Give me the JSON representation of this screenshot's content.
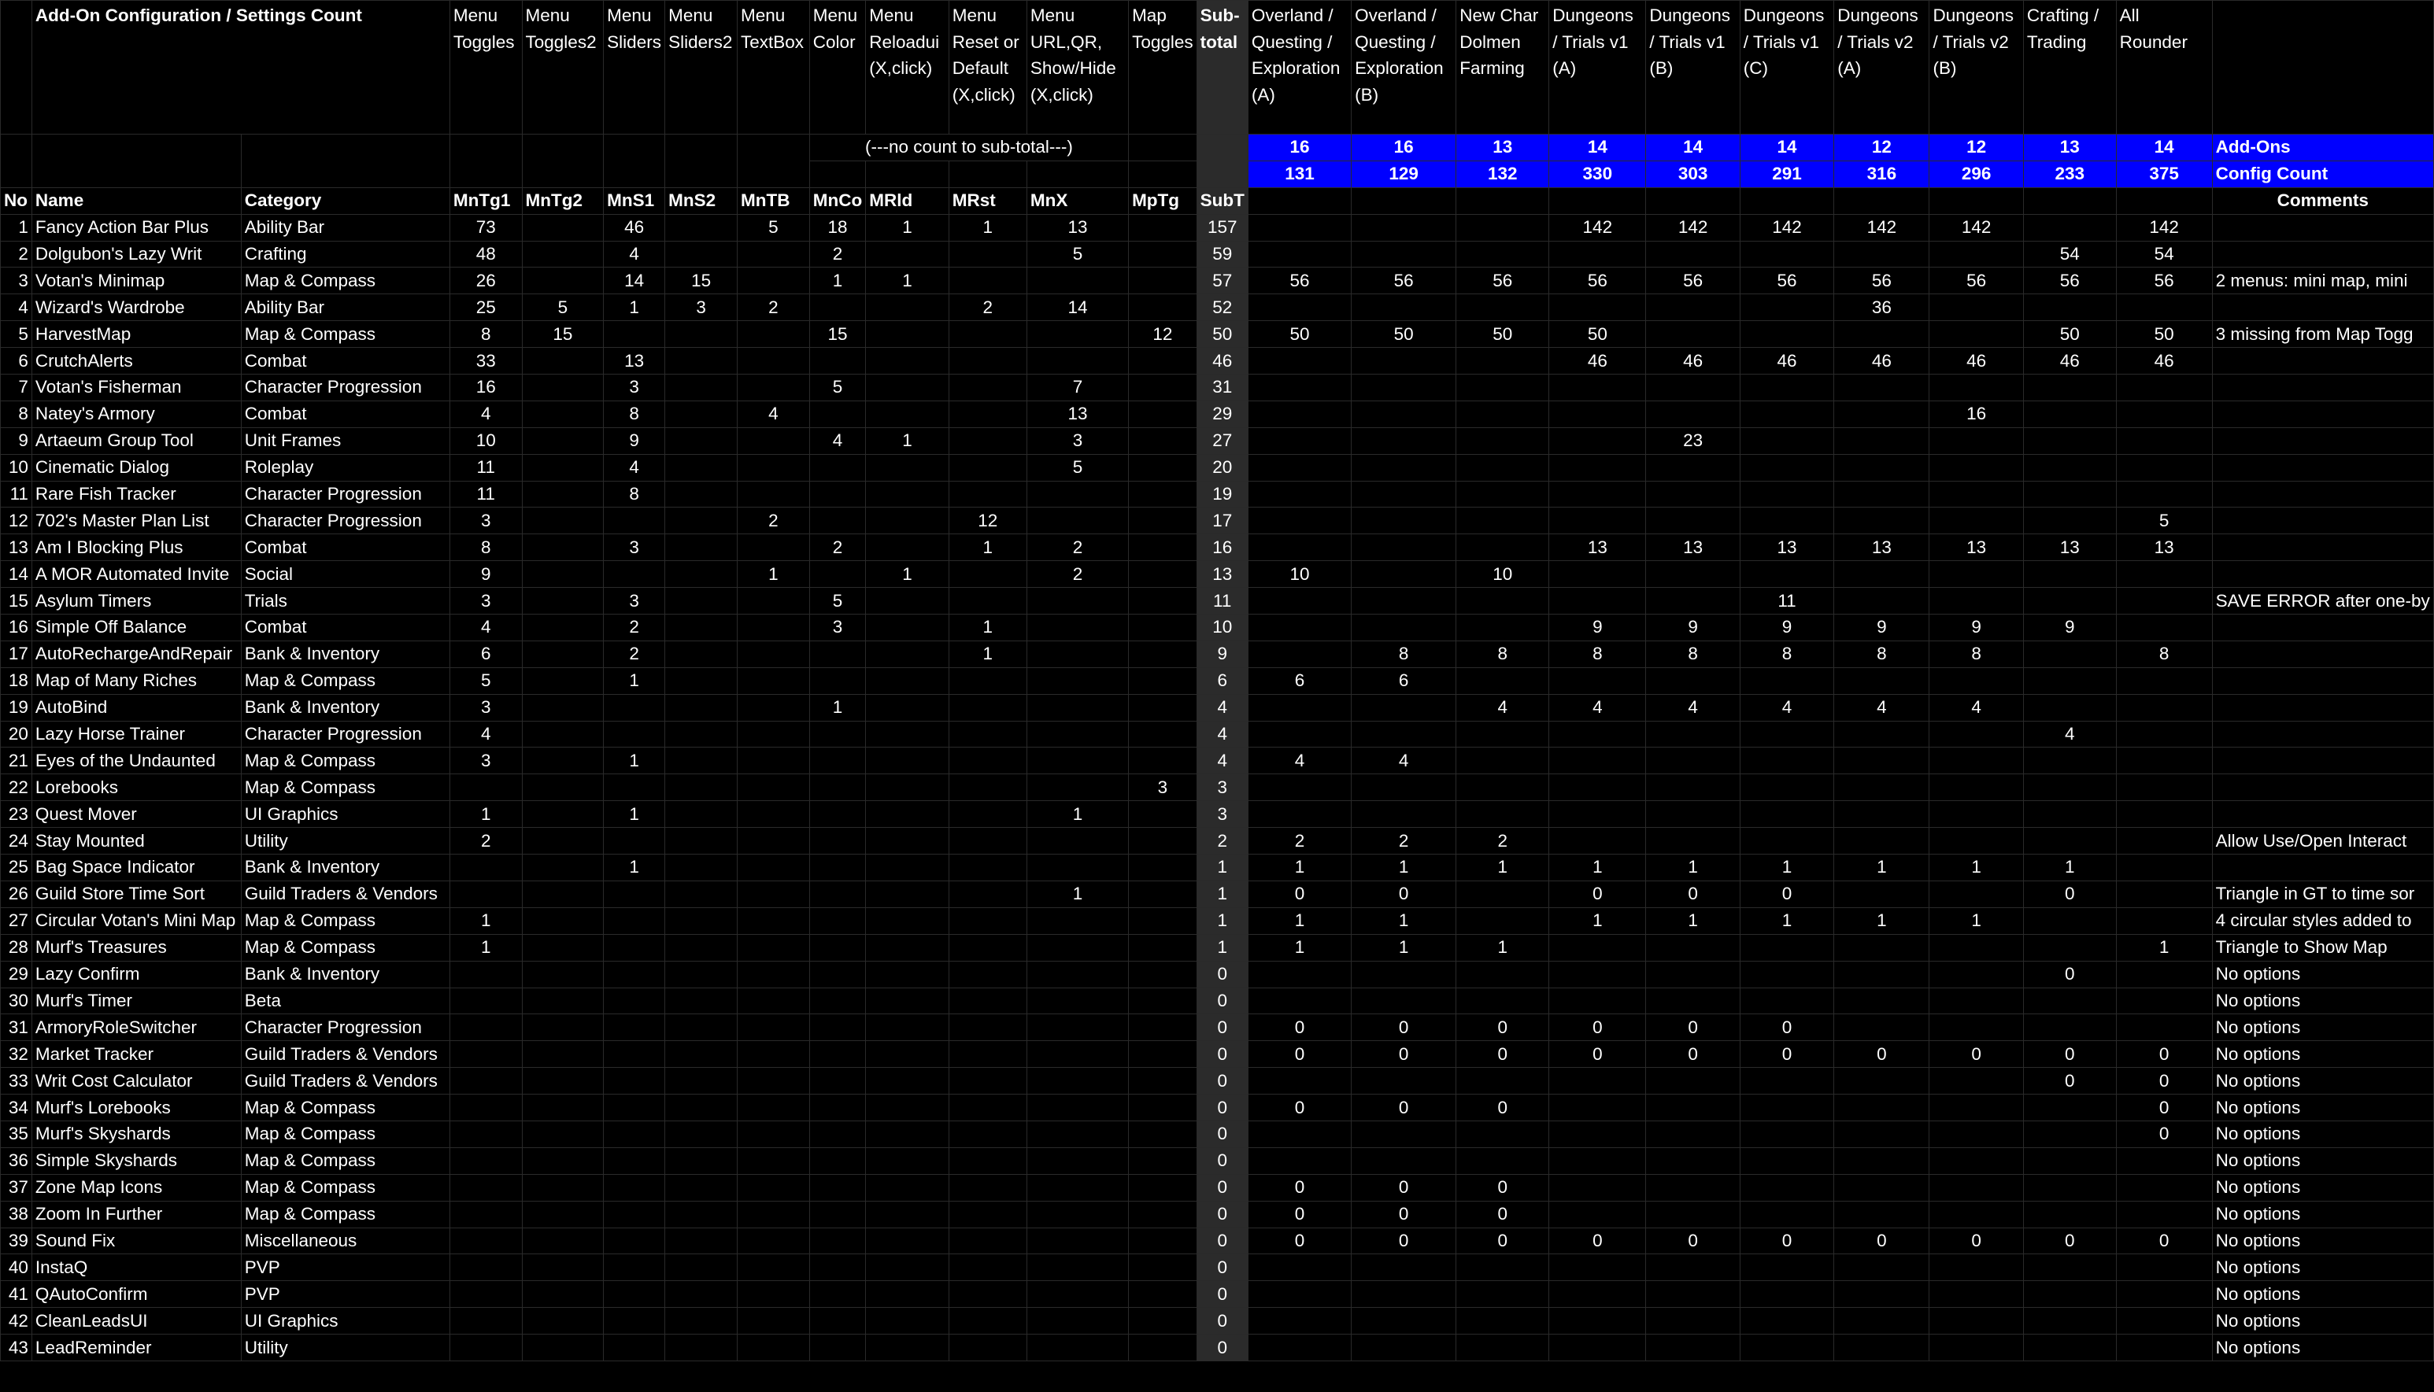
{
  "title": "Add-On Configuration / Settings Count",
  "note_no_count": "(---no count to sub-total---)",
  "menu_headers": [
    "Menu Toggles",
    "Menu Toggles2",
    "Menu Sliders",
    "Menu Sliders2",
    "Menu TextBox",
    "Menu Color",
    "Menu Reloadui (X,click)",
    "Menu Reset or Default (X,click)",
    "Menu URL,QR, Show/Hide (X,click)",
    "Map Toggles"
  ],
  "subtotal_header": "Sub-total",
  "profile_headers": [
    "Overland / Questing / Exploration (A)",
    "Overland / Questing / Exploration (B)",
    "New Char Dolmen Farming",
    "Dungeons / Trials v1 (A)",
    "Dungeons / Trials v1 (B)",
    "Dungeons / Trials v1 (C)",
    "Dungeons / Trials v2 (A)",
    "Dungeons / Trials v2 (B)",
    "Crafting / Trading",
    "All Rounder"
  ],
  "addon_counts": [
    "16",
    "16",
    "13",
    "14",
    "14",
    "14",
    "12",
    "12",
    "13",
    "14"
  ],
  "config_counts": [
    "131",
    "129",
    "132",
    "330",
    "303",
    "291",
    "316",
    "296",
    "233",
    "375"
  ],
  "addons_label": "Add-Ons",
  "config_label": "Config Count",
  "col_headers": {
    "no": "No",
    "name": "Name",
    "category": "Category",
    "menu": [
      "MnTg1",
      "MnTg2",
      "MnS1",
      "MnS2",
      "MnTB",
      "MnCo",
      "MRld",
      "MRst",
      "MnX",
      "MpTg"
    ],
    "subtotal": "SubT",
    "comments": "Comments"
  },
  "rows": [
    {
      "no": "1",
      "name": "Fancy Action Bar Plus",
      "cat": "Ability Bar",
      "m": [
        "73",
        "",
        "46",
        "",
        "5",
        "18",
        "1",
        "1",
        "13",
        ""
      ],
      "sub": "157",
      "p": [
        "",
        "",
        "",
        "142",
        "142",
        "142",
        "142",
        "142",
        "",
        "142"
      ],
      "c": ""
    },
    {
      "no": "2",
      "name": "Dolgubon's Lazy Writ",
      "cat": "Crafting",
      "m": [
        "48",
        "",
        "4",
        "",
        "",
        "2",
        "",
        "",
        "5",
        ""
      ],
      "sub": "59",
      "p": [
        "",
        "",
        "",
        "",
        "",
        "",
        "",
        "",
        "54",
        "54"
      ],
      "c": ""
    },
    {
      "no": "3",
      "name": "Votan's Minimap",
      "cat": "Map & Compass",
      "m": [
        "26",
        "",
        "14",
        "15",
        "",
        "1",
        "1",
        "",
        "",
        ""
      ],
      "sub": "57",
      "p": [
        "56",
        "56",
        "56",
        "56",
        "56",
        "56",
        "56",
        "56",
        "56",
        "56"
      ],
      "c": "2 menus: mini map, mini"
    },
    {
      "no": "4",
      "name": "Wizard's Wardrobe",
      "cat": "Ability Bar",
      "m": [
        "25",
        "5",
        "1",
        "3",
        "2",
        "",
        "",
        "2",
        "14",
        ""
      ],
      "sub": "52",
      "p": [
        "",
        "",
        "",
        "",
        "",
        "",
        "36",
        "",
        "",
        ""
      ],
      "c": ""
    },
    {
      "no": "5",
      "name": "HarvestMap",
      "cat": "Map & Compass",
      "m": [
        "8",
        "15",
        "",
        "",
        "",
        "15",
        "",
        "",
        "",
        "12"
      ],
      "sub": "50",
      "p": [
        "50",
        "50",
        "50",
        "50",
        "",
        "",
        "",
        "",
        "50",
        "50"
      ],
      "c": "3 missing from Map Togg"
    },
    {
      "no": "6",
      "name": "CrutchAlerts",
      "cat": "Combat",
      "m": [
        "33",
        "",
        "13",
        "",
        "",
        "",
        "",
        "",
        "",
        ""
      ],
      "sub": "46",
      "p": [
        "",
        "",
        "",
        "46",
        "46",
        "46",
        "46",
        "46",
        "46",
        "46"
      ],
      "c": ""
    },
    {
      "no": "7",
      "name": "Votan's Fisherman",
      "cat": "Character Progression",
      "m": [
        "16",
        "",
        "3",
        "",
        "",
        "5",
        "",
        "",
        "7",
        ""
      ],
      "sub": "31",
      "p": [
        "",
        "",
        "",
        "",
        "",
        "",
        "",
        "",
        "",
        ""
      ],
      "c": ""
    },
    {
      "no": "8",
      "name": "Natey's Armory",
      "cat": "Combat",
      "m": [
        "4",
        "",
        "8",
        "",
        "4",
        "",
        "",
        "",
        "13",
        ""
      ],
      "sub": "29",
      "p": [
        "",
        "",
        "",
        "",
        "",
        "",
        "",
        "16",
        "",
        ""
      ],
      "c": ""
    },
    {
      "no": "9",
      "name": "Artaeum Group Tool",
      "cat": "Unit Frames",
      "m": [
        "10",
        "",
        "9",
        "",
        "",
        "4",
        "1",
        "",
        "3",
        ""
      ],
      "sub": "27",
      "p": [
        "",
        "",
        "",
        "",
        "23",
        "",
        "",
        "",
        "",
        ""
      ],
      "c": ""
    },
    {
      "no": "10",
      "name": "Cinematic Dialog",
      "cat": "Roleplay",
      "m": [
        "11",
        "",
        "4",
        "",
        "",
        "",
        "",
        "",
        "5",
        ""
      ],
      "sub": "20",
      "p": [
        "",
        "",
        "",
        "",
        "",
        "",
        "",
        "",
        "",
        ""
      ],
      "c": ""
    },
    {
      "no": "11",
      "name": "Rare Fish Tracker",
      "cat": "Character Progression",
      "m": [
        "11",
        "",
        "8",
        "",
        "",
        "",
        "",
        "",
        "",
        ""
      ],
      "sub": "19",
      "p": [
        "",
        "",
        "",
        "",
        "",
        "",
        "",
        "",
        "",
        ""
      ],
      "c": ""
    },
    {
      "no": "12",
      "name": "702's Master Plan List",
      "cat": "Character Progression",
      "m": [
        "3",
        "",
        "",
        "",
        "2",
        "",
        "",
        "12",
        "",
        ""
      ],
      "sub": "17",
      "p": [
        "",
        "",
        "",
        "",
        "",
        "",
        "",
        "",
        "",
        "5"
      ],
      "c": ""
    },
    {
      "no": "13",
      "name": "Am I Blocking Plus",
      "cat": "Combat",
      "m": [
        "8",
        "",
        "3",
        "",
        "",
        "2",
        "",
        "1",
        "2",
        ""
      ],
      "sub": "16",
      "p": [
        "",
        "",
        "",
        "13",
        "13",
        "13",
        "13",
        "13",
        "13",
        "13"
      ],
      "c": ""
    },
    {
      "no": "14",
      "name": "A MOR Automated Invite",
      "cat": "Social",
      "m": [
        "9",
        "",
        "",
        "",
        "1",
        "",
        "1",
        "",
        "2",
        ""
      ],
      "sub": "13",
      "p": [
        "10",
        "",
        "10",
        "",
        "",
        "",
        "",
        "",
        "",
        ""
      ],
      "c": ""
    },
    {
      "no": "15",
      "name": "Asylum Timers",
      "cat": "Trials",
      "m": [
        "3",
        "",
        "3",
        "",
        "",
        "5",
        "",
        "",
        "",
        ""
      ],
      "sub": "11",
      "p": [
        "",
        "",
        "",
        "",
        "",
        "11",
        "",
        "",
        "",
        ""
      ],
      "c": "SAVE ERROR after one-by"
    },
    {
      "no": "16",
      "name": "Simple Off Balance",
      "cat": "Combat",
      "m": [
        "4",
        "",
        "2",
        "",
        "",
        "3",
        "",
        "1",
        "",
        ""
      ],
      "sub": "10",
      "p": [
        "",
        "",
        "",
        "9",
        "9",
        "9",
        "9",
        "9",
        "9",
        ""
      ],
      "c": ""
    },
    {
      "no": "17",
      "name": "AutoRechargeAndRepair",
      "cat": "Bank & Inventory",
      "m": [
        "6",
        "",
        "2",
        "",
        "",
        "",
        "",
        "1",
        "",
        ""
      ],
      "sub": "9",
      "p": [
        "",
        "8",
        "8",
        "8",
        "8",
        "8",
        "8",
        "8",
        "",
        "8"
      ],
      "c": ""
    },
    {
      "no": "18",
      "name": "Map of Many Riches",
      "cat": "Map & Compass",
      "m": [
        "5",
        "",
        "1",
        "",
        "",
        "",
        "",
        "",
        "",
        ""
      ],
      "sub": "6",
      "p": [
        "6",
        "6",
        "",
        "",
        "",
        "",
        "",
        "",
        "",
        ""
      ],
      "c": ""
    },
    {
      "no": "19",
      "name": "AutoBind",
      "cat": "Bank & Inventory",
      "m": [
        "3",
        "",
        "",
        "",
        "",
        "1",
        "",
        "",
        "",
        ""
      ],
      "sub": "4",
      "p": [
        "",
        "",
        "4",
        "4",
        "4",
        "4",
        "4",
        "4",
        "",
        ""
      ],
      "c": ""
    },
    {
      "no": "20",
      "name": "Lazy Horse Trainer",
      "cat": "Character Progression",
      "m": [
        "4",
        "",
        "",
        "",
        "",
        "",
        "",
        "",
        "",
        ""
      ],
      "sub": "4",
      "p": [
        "",
        "",
        "",
        "",
        "",
        "",
        "",
        "",
        "4",
        ""
      ],
      "c": ""
    },
    {
      "no": "21",
      "name": "Eyes of the Undaunted",
      "cat": "Map & Compass",
      "m": [
        "3",
        "",
        "1",
        "",
        "",
        "",
        "",
        "",
        "",
        ""
      ],
      "sub": "4",
      "p": [
        "4",
        "4",
        "",
        "",
        "",
        "",
        "",
        "",
        "",
        ""
      ],
      "c": ""
    },
    {
      "no": "22",
      "name": "Lorebooks",
      "cat": "Map & Compass",
      "m": [
        "",
        "",
        "",
        "",
        "",
        "",
        "",
        "",
        "",
        "3"
      ],
      "sub": "3",
      "p": [
        "",
        "",
        "",
        "",
        "",
        "",
        "",
        "",
        "",
        ""
      ],
      "c": ""
    },
    {
      "no": "23",
      "name": "Quest Mover",
      "cat": "UI Graphics",
      "m": [
        "1",
        "",
        "1",
        "",
        "",
        "",
        "",
        "",
        "1",
        ""
      ],
      "sub": "3",
      "p": [
        "",
        "",
        "",
        "",
        "",
        "",
        "",
        "",
        "",
        ""
      ],
      "c": ""
    },
    {
      "no": "24",
      "name": "Stay Mounted",
      "cat": "Utility",
      "m": [
        "2",
        "",
        "",
        "",
        "",
        "",
        "",
        "",
        "",
        ""
      ],
      "sub": "2",
      "p": [
        "2",
        "2",
        "2",
        "",
        "",
        "",
        "",
        "",
        "",
        ""
      ],
      "c": "Allow Use/Open Interact"
    },
    {
      "no": "25",
      "name": "Bag Space Indicator",
      "cat": "Bank & Inventory",
      "m": [
        "",
        "",
        "1",
        "",
        "",
        "",
        "",
        "",
        "",
        ""
      ],
      "sub": "1",
      "p": [
        "1",
        "1",
        "1",
        "1",
        "1",
        "1",
        "1",
        "1",
        "1",
        ""
      ],
      "c": ""
    },
    {
      "no": "26",
      "name": "Guild Store Time Sort",
      "cat": "Guild Traders & Vendors",
      "m": [
        "",
        "",
        "",
        "",
        "",
        "",
        "",
        "",
        "1",
        ""
      ],
      "sub": "1",
      "p": [
        "0",
        "0",
        "",
        "0",
        "0",
        "0",
        "",
        "",
        "0",
        ""
      ],
      "c": "Triangle in GT to time sor"
    },
    {
      "no": "27",
      "name": "Circular Votan's Mini Map",
      "cat": "Map & Compass",
      "m": [
        "1",
        "",
        "",
        "",
        "",
        "",
        "",
        "",
        "",
        ""
      ],
      "sub": "1",
      "p": [
        "1",
        "1",
        "",
        "1",
        "1",
        "1",
        "1",
        "1",
        "",
        ""
      ],
      "c": "4 circular styles added to"
    },
    {
      "no": "28",
      "name": "Murf's Treasures",
      "cat": "Map & Compass",
      "m": [
        "1",
        "",
        "",
        "",
        "",
        "",
        "",
        "",
        "",
        ""
      ],
      "sub": "1",
      "p": [
        "1",
        "1",
        "1",
        "",
        "",
        "",
        "",
        "",
        "",
        "1"
      ],
      "c": "Triangle to Show Map"
    },
    {
      "no": "29",
      "name": "Lazy Confirm",
      "cat": "Bank & Inventory",
      "m": [
        "",
        "",
        "",
        "",
        "",
        "",
        "",
        "",
        "",
        ""
      ],
      "sub": "0",
      "p": [
        "",
        "",
        "",
        "",
        "",
        "",
        "",
        "",
        "0",
        ""
      ],
      "c": "No options"
    },
    {
      "no": "30",
      "name": "Murf's Timer",
      "cat": "Beta",
      "m": [
        "",
        "",
        "",
        "",
        "",
        "",
        "",
        "",
        "",
        ""
      ],
      "sub": "0",
      "p": [
        "",
        "",
        "",
        "",
        "",
        "",
        "",
        "",
        "",
        ""
      ],
      "c": "No options"
    },
    {
      "no": "31",
      "name": "ArmoryRoleSwitcher",
      "cat": "Character Progression",
      "m": [
        "",
        "",
        "",
        "",
        "",
        "",
        "",
        "",
        "",
        ""
      ],
      "sub": "0",
      "p": [
        "0",
        "0",
        "0",
        "0",
        "0",
        "0",
        "",
        "",
        "",
        ""
      ],
      "c": "No options"
    },
    {
      "no": "32",
      "name": "Market Tracker",
      "cat": "Guild Traders & Vendors",
      "m": [
        "",
        "",
        "",
        "",
        "",
        "",
        "",
        "",
        "",
        ""
      ],
      "sub": "0",
      "p": [
        "0",
        "0",
        "0",
        "0",
        "0",
        "0",
        "0",
        "0",
        "0",
        "0"
      ],
      "c": "No options"
    },
    {
      "no": "33",
      "name": "Writ Cost Calculator",
      "cat": "Guild Traders & Vendors",
      "m": [
        "",
        "",
        "",
        "",
        "",
        "",
        "",
        "",
        "",
        ""
      ],
      "sub": "0",
      "p": [
        "",
        "",
        "",
        "",
        "",
        "",
        "",
        "",
        "0",
        "0"
      ],
      "c": "No options"
    },
    {
      "no": "34",
      "name": "Murf's Lorebooks",
      "cat": "Map & Compass",
      "m": [
        "",
        "",
        "",
        "",
        "",
        "",
        "",
        "",
        "",
        ""
      ],
      "sub": "0",
      "p": [
        "0",
        "0",
        "0",
        "",
        "",
        "",
        "",
        "",
        "",
        "0"
      ],
      "c": "No options"
    },
    {
      "no": "35",
      "name": "Murf's Skyshards",
      "cat": "Map & Compass",
      "m": [
        "",
        "",
        "",
        "",
        "",
        "",
        "",
        "",
        "",
        ""
      ],
      "sub": "0",
      "p": [
        "",
        "",
        "",
        "",
        "",
        "",
        "",
        "",
        "",
        "0"
      ],
      "c": "No options"
    },
    {
      "no": "36",
      "name": "Simple Skyshards",
      "cat": "Map & Compass",
      "m": [
        "",
        "",
        "",
        "",
        "",
        "",
        "",
        "",
        "",
        ""
      ],
      "sub": "0",
      "p": [
        "",
        "",
        "",
        "",
        "",
        "",
        "",
        "",
        "",
        ""
      ],
      "c": "No options"
    },
    {
      "no": "37",
      "name": "Zone Map Icons",
      "cat": "Map & Compass",
      "m": [
        "",
        "",
        "",
        "",
        "",
        "",
        "",
        "",
        "",
        ""
      ],
      "sub": "0",
      "p": [
        "0",
        "0",
        "0",
        "",
        "",
        "",
        "",
        "",
        "",
        ""
      ],
      "c": "No options"
    },
    {
      "no": "38",
      "name": "Zoom In Further",
      "cat": "Map & Compass",
      "m": [
        "",
        "",
        "",
        "",
        "",
        "",
        "",
        "",
        "",
        ""
      ],
      "sub": "0",
      "p": [
        "0",
        "0",
        "0",
        "",
        "",
        "",
        "",
        "",
        "",
        ""
      ],
      "c": "No options"
    },
    {
      "no": "39",
      "name": "Sound Fix",
      "cat": "Miscellaneous",
      "m": [
        "",
        "",
        "",
        "",
        "",
        "",
        "",
        "",
        "",
        ""
      ],
      "sub": "0",
      "p": [
        "0",
        "0",
        "0",
        "0",
        "0",
        "0",
        "0",
        "0",
        "0",
        "0"
      ],
      "c": "No options"
    },
    {
      "no": "40",
      "name": "InstaQ",
      "cat": "PVP",
      "m": [
        "",
        "",
        "",
        "",
        "",
        "",
        "",
        "",
        "",
        ""
      ],
      "sub": "0",
      "p": [
        "",
        "",
        "",
        "",
        "",
        "",
        "",
        "",
        "",
        ""
      ],
      "c": "No options"
    },
    {
      "no": "41",
      "name": "QAutoConfirm",
      "cat": "PVP",
      "m": [
        "",
        "",
        "",
        "",
        "",
        "",
        "",
        "",
        "",
        ""
      ],
      "sub": "0",
      "p": [
        "",
        "",
        "",
        "",
        "",
        "",
        "",
        "",
        "",
        ""
      ],
      "c": "No options"
    },
    {
      "no": "42",
      "name": "CleanLeadsUI",
      "cat": "UI Graphics",
      "m": [
        "",
        "",
        "",
        "",
        "",
        "",
        "",
        "",
        "",
        ""
      ],
      "sub": "0",
      "p": [
        "",
        "",
        "",
        "",
        "",
        "",
        "",
        "",
        "",
        ""
      ],
      "c": "No options"
    },
    {
      "no": "43",
      "name": "LeadReminder",
      "cat": "Utility",
      "m": [
        "",
        "",
        "",
        "",
        "",
        "",
        "",
        "",
        "",
        ""
      ],
      "sub": "0",
      "p": [
        "",
        "",
        "",
        "",
        "",
        "",
        "",
        "",
        "",
        ""
      ],
      "c": "No options"
    }
  ]
}
